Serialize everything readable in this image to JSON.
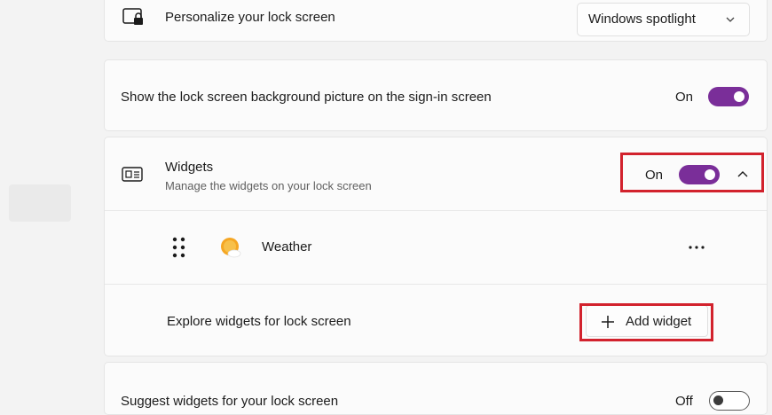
{
  "lock_screen": {
    "personalize": {
      "label": "Personalize your lock screen",
      "dropdown_value": "Windows spotlight"
    },
    "background_on_signin": {
      "label": "Show the lock screen background picture on the sign-in screen",
      "state": "On"
    },
    "widgets": {
      "title": "Widgets",
      "subtitle": "Manage the widgets on your lock screen",
      "state": "On",
      "items": [
        {
          "name": "Weather"
        }
      ],
      "explore_label": "Explore widgets for lock screen",
      "add_button_label": "Add widget"
    },
    "suggest_widgets": {
      "label": "Suggest widgets for your lock screen",
      "state": "Off"
    }
  },
  "icons": [
    "lock-screen-icon",
    "chevron-down-icon",
    "widgets-icon",
    "chevron-up-icon",
    "drag-handle-icon",
    "weather-icon",
    "more-options-icon",
    "plus-icon"
  ],
  "colors": {
    "toggle_on": "#7a2e99",
    "highlight": "#d2222d"
  }
}
